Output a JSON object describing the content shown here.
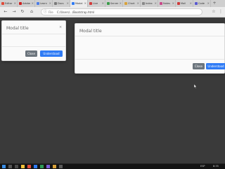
{
  "browser": {
    "tabs": [
      {
        "label": "Editar",
        "favicon": "#e04a3a",
        "active": false
      },
      {
        "label": "Adobe",
        "favicon": "#cc2222",
        "active": false
      },
      {
        "label": "Learn",
        "favicon": "#4e7ee6",
        "active": false
      },
      {
        "label": "Docs",
        "favicon": "#7a7a7a",
        "active": false
      },
      {
        "label": "Modal",
        "favicon": "#2f7bf5",
        "active": true
      },
      {
        "label": "Live",
        "favicon": "#d23c3c",
        "active": false
      },
      {
        "label": "Server",
        "favicon": "#3a9c4a",
        "active": false
      },
      {
        "label": "Chart",
        "favicon": "#d9a23a",
        "active": false
      },
      {
        "label": "Index",
        "favicon": "#888888",
        "active": false
      },
      {
        "label": "Notes",
        "favicon": "#c84a8a",
        "active": false
      },
      {
        "label": "Mail",
        "favicon": "#cf3b3b",
        "active": false
      },
      {
        "label": "Code",
        "favicon": "#5a5ad0",
        "active": false
      }
    ],
    "new_tab_label": "+",
    "address": {
      "scheme": "File",
      "url": "C:/Users/.../Bootstrap.html"
    }
  },
  "modals": [
    {
      "title": "Modal title",
      "close_label": "×",
      "secondary_label": "Close",
      "primary_label": "Understood"
    },
    {
      "title": "Modal title",
      "secondary_label": "Close",
      "primary_label": "Understood"
    }
  ],
  "taskbar": {
    "tray_items": [
      "ESP",
      "8:35"
    ]
  },
  "colors": {
    "primary_button": "#2f7bf5",
    "secondary_button": "#6c757d",
    "page_background": "#3a3a3a"
  }
}
